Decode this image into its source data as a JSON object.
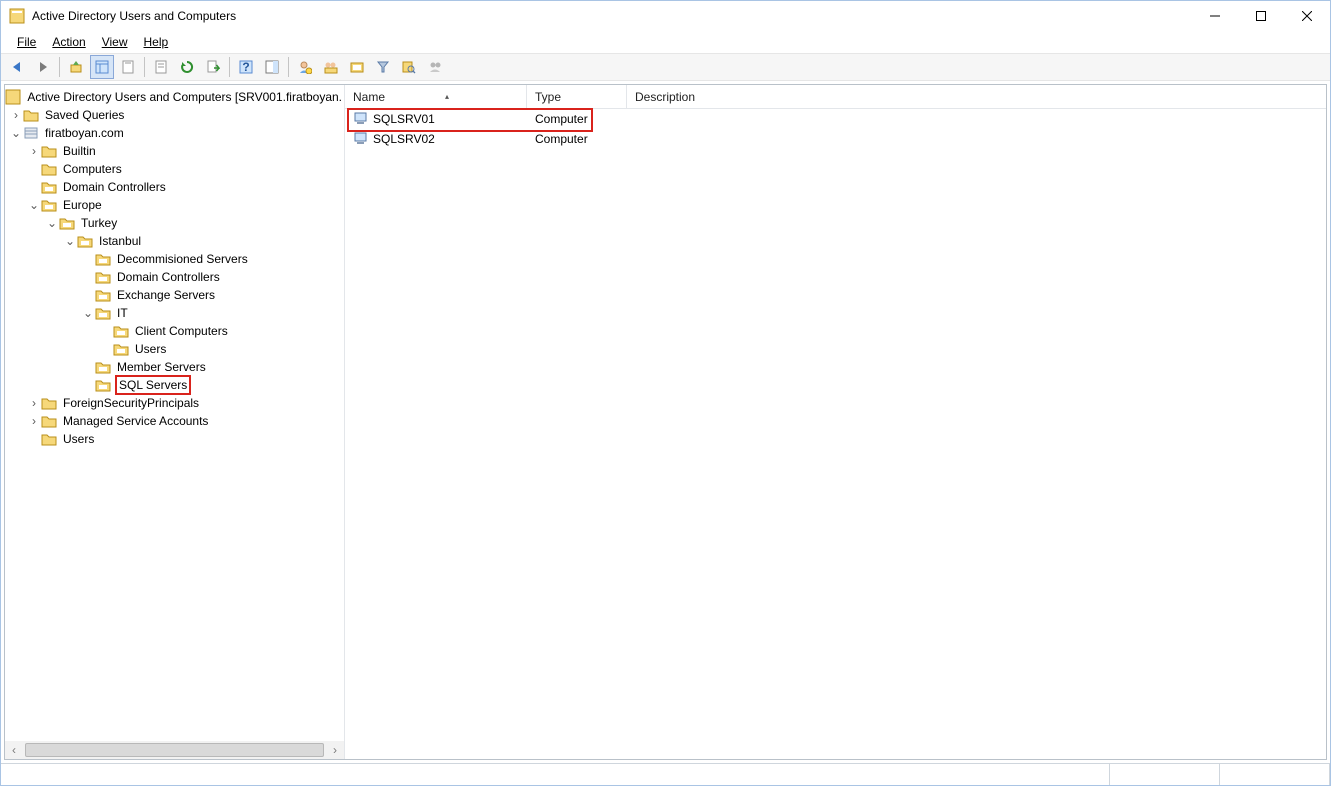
{
  "title": "Active Directory Users and Computers",
  "menu": {
    "file": "File",
    "action": "Action",
    "view": "View",
    "help": "Help"
  },
  "tree": {
    "root": "Active Directory Users and Computers [SRV001.firatboyan.",
    "saved_queries": "Saved Queries",
    "domain": "firatboyan.com",
    "builtin": "Builtin",
    "computers": "Computers",
    "domain_controllers": "Domain Controllers",
    "europe": "Europe",
    "turkey": "Turkey",
    "istanbul": "Istanbul",
    "decommissioned": "Decommisioned Servers",
    "istanbul_dc": "Domain Controllers",
    "exchange": "Exchange Servers",
    "it": "IT",
    "client_computers": "Client Computers",
    "it_users": "Users",
    "member_servers": "Member Servers",
    "sql_servers": "SQL Servers",
    "fsp": "ForeignSecurityPrincipals",
    "msa": "Managed Service Accounts",
    "users": "Users"
  },
  "columns": {
    "name": "Name",
    "type": "Type",
    "description": "Description"
  },
  "rows": [
    {
      "name": "SQLSRV01",
      "type": "Computer",
      "highlighted": true
    },
    {
      "name": "SQLSRV02",
      "type": "Computer",
      "highlighted": false
    }
  ]
}
